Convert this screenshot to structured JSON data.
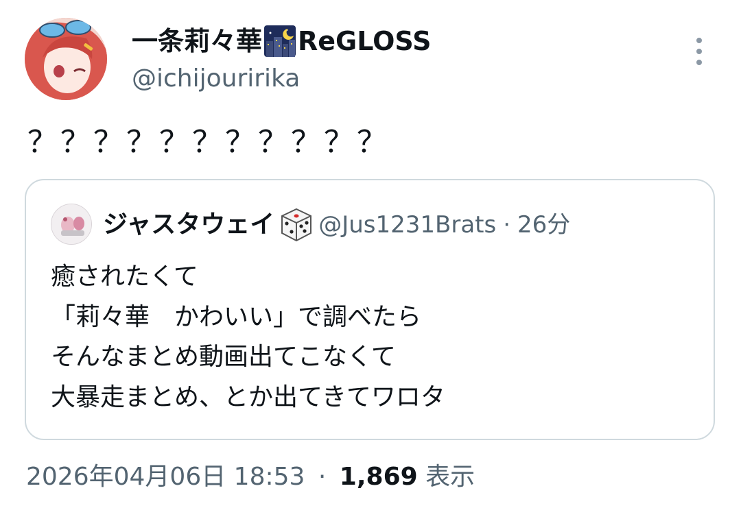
{
  "author": {
    "name_prefix": "一条莉々華",
    "name_suffix": "ReGLOSS",
    "badge_icon": "night-city-emoji-icon",
    "handle": "@ichijouririka"
  },
  "menu": {
    "icon": "more-vertical-icon"
  },
  "tweet": {
    "text": "？？？？？？？？？？？"
  },
  "quoted": {
    "avatar_icon": "avatar-image",
    "name": "ジャスタウェイ",
    "name_icon": "dice-emoji-icon",
    "handle": "@Jus1231Brats",
    "separator": "·",
    "time": "26分",
    "lines": [
      "癒されたくて",
      "「莉々華　かわいい」で調べたら",
      "そんなまとめ動画出てこなくて",
      "大暴走まとめ、とか出てきてワロタ"
    ]
  },
  "footer": {
    "timestamp": "2026年04月06日 18:53",
    "separator": "·",
    "views_count": "1,869",
    "views_label": "表示"
  },
  "colors": {
    "text": "#0f1419",
    "muted": "#536471",
    "border": "#cfd9de"
  }
}
